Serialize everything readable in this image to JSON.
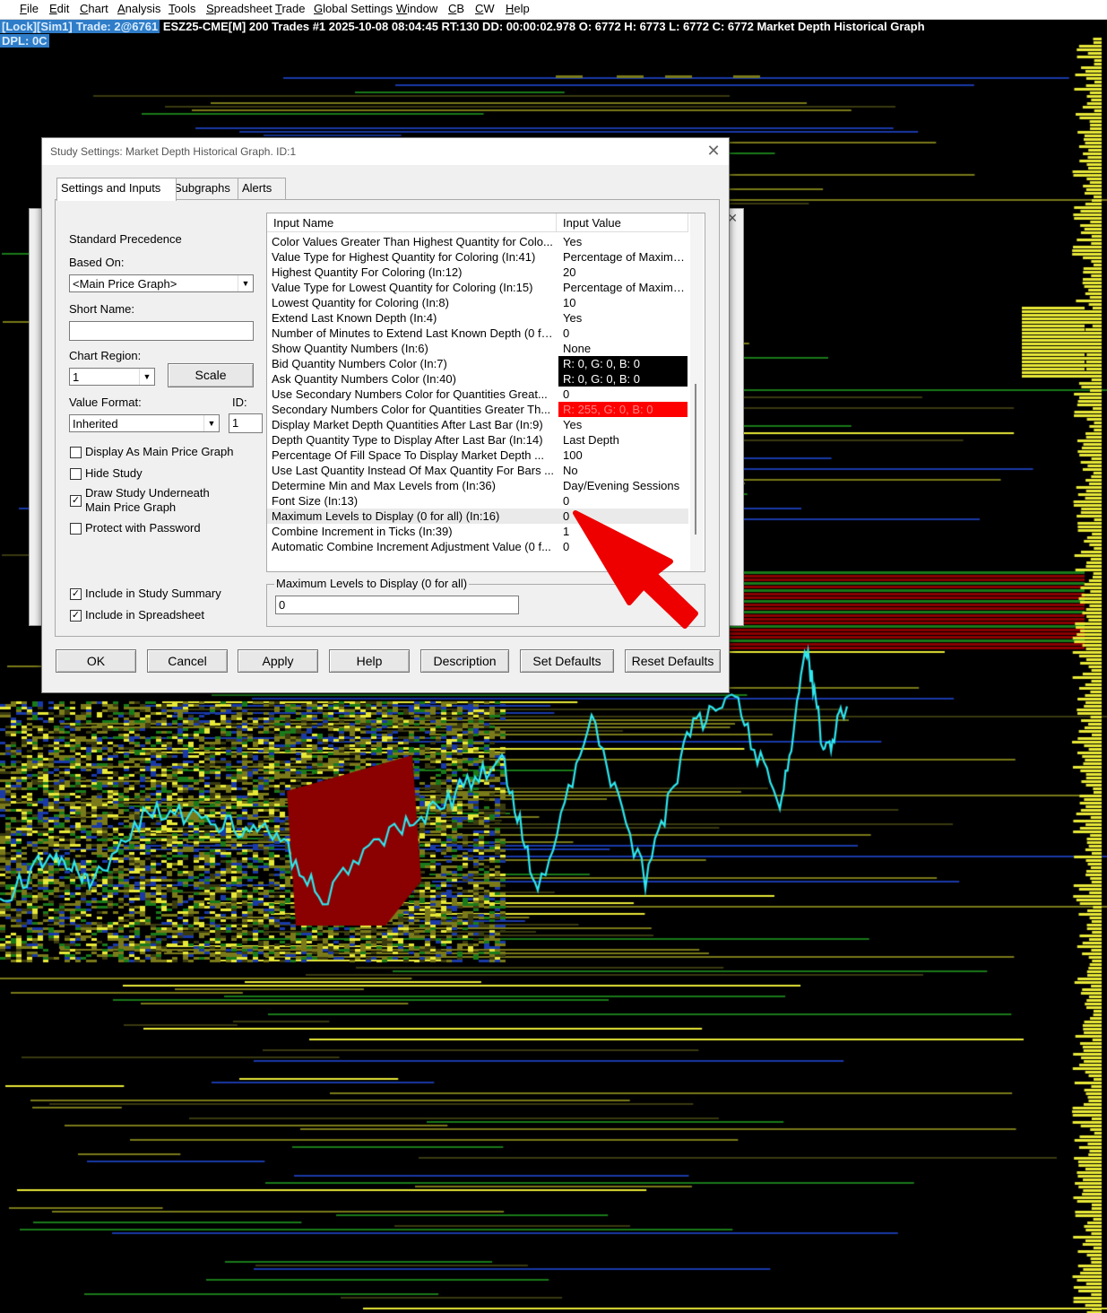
{
  "menu": [
    "File",
    "Edit",
    "Chart",
    "Analysis",
    "Tools",
    "Spreadsheet",
    "Trade",
    "Global Settings",
    "Window",
    "CB",
    "CW",
    "Help"
  ],
  "chart_header": {
    "lock_label": "[Lock][Sim1]",
    "trade_label": "Trade: 2@6761",
    "info": "ESZ25-CME[M]  200 Trades #1 2025-10-08 08:04:45 RT:130 DD: 00:00:02.978 O: 6772 H: 6773 L: 6772 C: 6772 Market Depth Historical Graph",
    "dpl": "DPL: 0C"
  },
  "colors": {
    "price_line": "#2ee8f0",
    "heat_red": "#8b0000",
    "heat_yellow": "#e8e838",
    "heat_olive": "#7a7a1a",
    "heat_green": "#1a7a1a",
    "heat_blue": "#1a3aa8",
    "arrow": "#ee0000"
  },
  "dialog": {
    "title": "Study Settings: Market Depth Historical Graph. ID:1",
    "close_icon": "close-icon",
    "tabs": [
      "Settings and Inputs",
      "Subgraphs",
      "Alerts"
    ],
    "precedence_label": "Standard Precedence",
    "based_on_label": "Based On:",
    "based_on_value": "<Main Price Graph>",
    "short_name_label": "Short Name:",
    "short_name_value": "",
    "chart_region_label": "Chart Region:",
    "chart_region_value": "1",
    "scale_button": "Scale",
    "value_format_label": "Value Format:",
    "value_format_value": "Inherited",
    "id_label": "ID:",
    "id_value": "1",
    "checkboxes": [
      {
        "label": "Display As Main Price Graph",
        "checked": false
      },
      {
        "label": "Hide Study",
        "checked": false
      },
      {
        "label": "Draw Study Underneath",
        "label2": "Main Price Graph",
        "checked": true
      },
      {
        "label": "Protect with Password",
        "checked": false
      }
    ],
    "bottom_checkboxes": [
      {
        "label": "Include in Study Summary",
        "checked": true
      },
      {
        "label": "Include in Spreadsheet",
        "checked": true
      }
    ],
    "grid": {
      "col_name": "Input Name",
      "col_value": "Input Value",
      "rows": [
        {
          "name": "Color Values Greater Than Highest Quantity for Colo...",
          "value": "Yes"
        },
        {
          "name": "Value Type for Highest Quantity for Coloring  (In:41)",
          "value": "Percentage of Maximu..."
        },
        {
          "name": "Highest Quantity For Coloring  (In:12)",
          "value": "20"
        },
        {
          "name": "Value Type for Lowest Quantity for Coloring  (In:15)",
          "value": "Percentage of Maximu..."
        },
        {
          "name": "Lowest Quantity for Coloring  (In:8)",
          "value": "10"
        },
        {
          "name": "Extend Last Known Depth  (In:4)",
          "value": "Yes"
        },
        {
          "name": "Number of Minutes to Extend Last Known Depth (0 fo...",
          "value": "0"
        },
        {
          "name": "Show Quantity Numbers  (In:6)",
          "value": "None"
        },
        {
          "name": "Bid Quantity Numbers Color  (In:7)",
          "value": "R: 0, G: 0, B: 0",
          "swatch": "#000000"
        },
        {
          "name": "Ask Quantity Numbers Color  (In:40)",
          "value": "R: 0, G: 0, B: 0",
          "swatch": "#000000"
        },
        {
          "name": "Use Secondary Numbers Color for Quantities Great...",
          "value": "0"
        },
        {
          "name": "Secondary Numbers Color for Quantities Greater Th...",
          "value": "R: 255, G: 0, B: 0",
          "swatch": "#ff0000"
        },
        {
          "name": "Display Market Depth Quantities After Last Bar  (In:9)",
          "value": "Yes"
        },
        {
          "name": "Depth Quantity Type to Display After Last Bar  (In:14)",
          "value": "Last Depth"
        },
        {
          "name": "Percentage Of Fill Space To Display Market Depth ...",
          "value": "100"
        },
        {
          "name": "Use Last Quantity Instead Of Max Quantity For Bars  ...",
          "value": "No"
        },
        {
          "name": "Determine Min and Max Levels from  (In:36)",
          "value": "Day/Evening Sessions"
        },
        {
          "name": "Font Size  (In:13)",
          "value": "0"
        },
        {
          "name": "Maximum Levels to Display (0 for all)  (In:16)",
          "value": "0",
          "selected": true
        },
        {
          "name": "Combine Increment in Ticks  (In:39)",
          "value": "1"
        },
        {
          "name": "Automatic Combine Increment Adjustment Value (0 f...",
          "value": "0"
        }
      ]
    },
    "editor_label": "Maximum Levels to Display (0 for all)",
    "editor_value": "0",
    "buttons": [
      "OK",
      "Cancel",
      "Apply",
      "Help",
      "Description",
      "Set Defaults",
      "Reset Defaults"
    ]
  }
}
